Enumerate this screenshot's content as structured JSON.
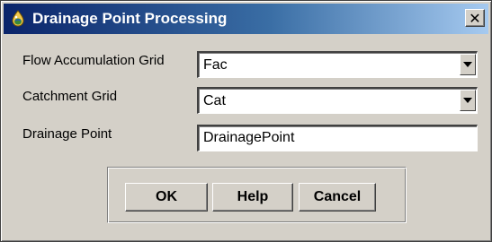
{
  "window": {
    "title": "Drainage Point Processing",
    "close_symbol": "✕",
    "icon": "globe-drop-icon"
  },
  "form": {
    "flow_accumulation": {
      "label": "Flow Accumulation Grid",
      "value": "Fac"
    },
    "catchment": {
      "label": "Catchment Grid",
      "value": "Cat"
    },
    "drainage_point": {
      "label": "Drainage Point",
      "value": "DrainagePoint"
    }
  },
  "buttons": {
    "ok": "OK",
    "help": "Help",
    "cancel": "Cancel"
  },
  "colors": {
    "title_bar_start": "#0a246a",
    "title_bar_end": "#a6caf0",
    "dialog_face": "#d4d0c8"
  }
}
